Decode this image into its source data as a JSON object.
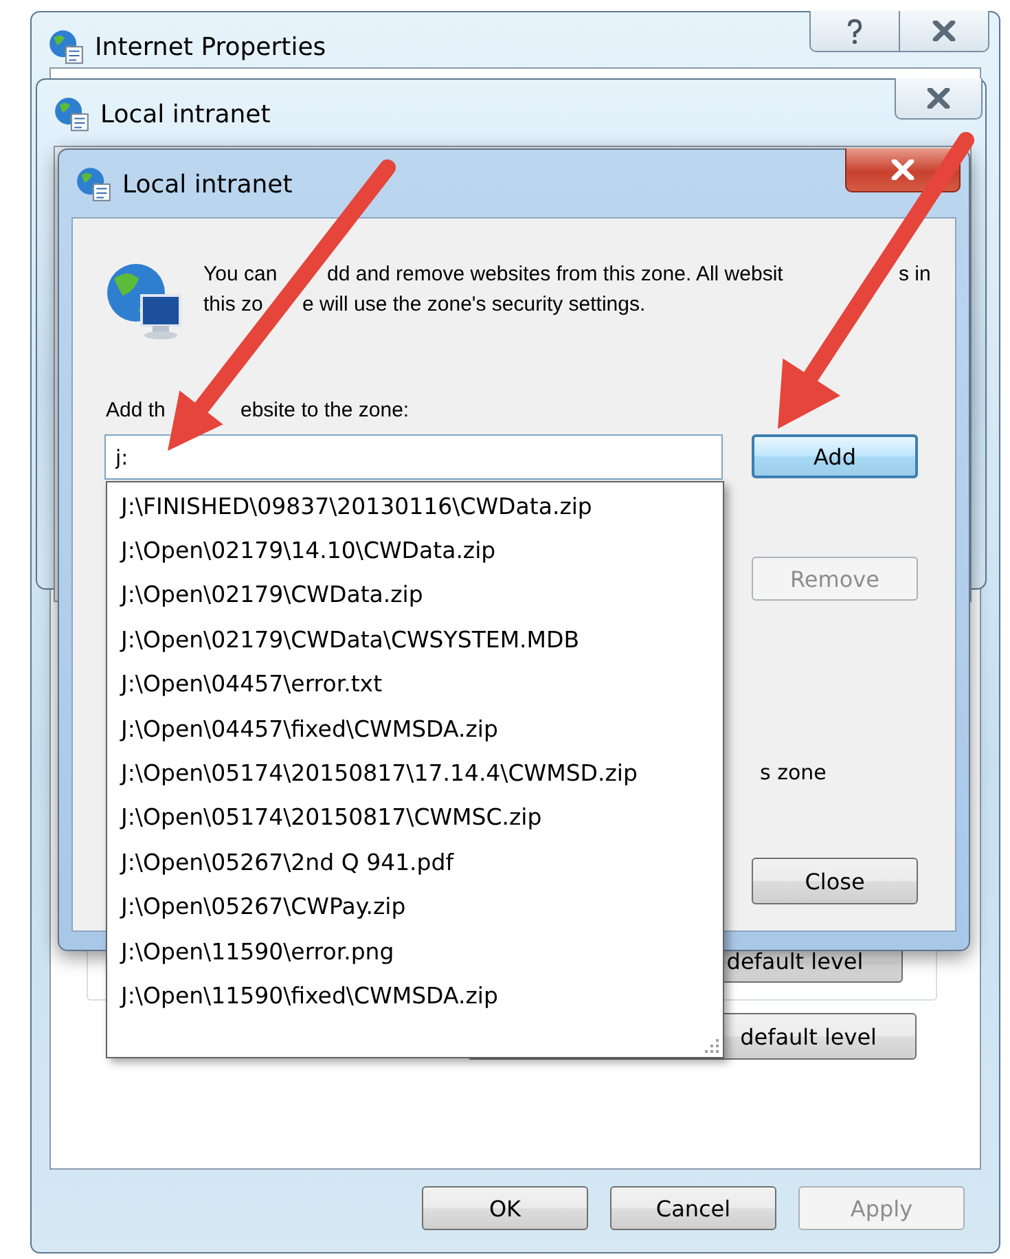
{
  "internet_properties": {
    "title": "Internet Properties",
    "buttons": [
      {
        "label": "OK",
        "disabled": false
      },
      {
        "label": "Cancel",
        "disabled": false
      },
      {
        "label": "Apply",
        "disabled": true
      }
    ],
    "background_buttons": [
      "default level",
      "default level"
    ]
  },
  "zone_window": {
    "title": "Local intranet"
  },
  "sites_dialog": {
    "title": "Local intranet",
    "description_lines": [
      [
        "You can",
        "dd and remove websites from this zone. All websit",
        "s in"
      ],
      [
        "this zo",
        "e will use the zone's security settings."
      ]
    ],
    "add_label_parts": [
      "Add th",
      "ebsite to the zone:"
    ],
    "website_field": {
      "value": "j:"
    },
    "buttons": [
      {
        "label": "Add",
        "disabled": false,
        "focused": true
      },
      {
        "label": "Remove",
        "disabled": true,
        "focused": false
      }
    ],
    "partial_text": "s zone",
    "close_button": "Close",
    "autocomplete": [
      "J:\\FINISHED\\09837\\20130116\\CWData.zip",
      "J:\\Open\\02179\\14.10\\CWData.zip",
      "J:\\Open\\02179\\CWData.zip",
      "J:\\Open\\02179\\CWData\\CWSYSTEM.MDB",
      "J:\\Open\\04457\\error.txt",
      "J:\\Open\\04457\\fixed\\CWMSDA.zip",
      "J:\\Open\\05174\\20150817\\17.14.4\\CWMSD.zip",
      "J:\\Open\\05174\\20150817\\CWMSC.zip",
      "J:\\Open\\05267\\2nd Q 941.pdf",
      "J:\\Open\\05267\\CWPay.zip",
      "J:\\Open\\11590\\error.png",
      "J:\\Open\\11590\\fixed\\CWMSDA.zip"
    ]
  }
}
